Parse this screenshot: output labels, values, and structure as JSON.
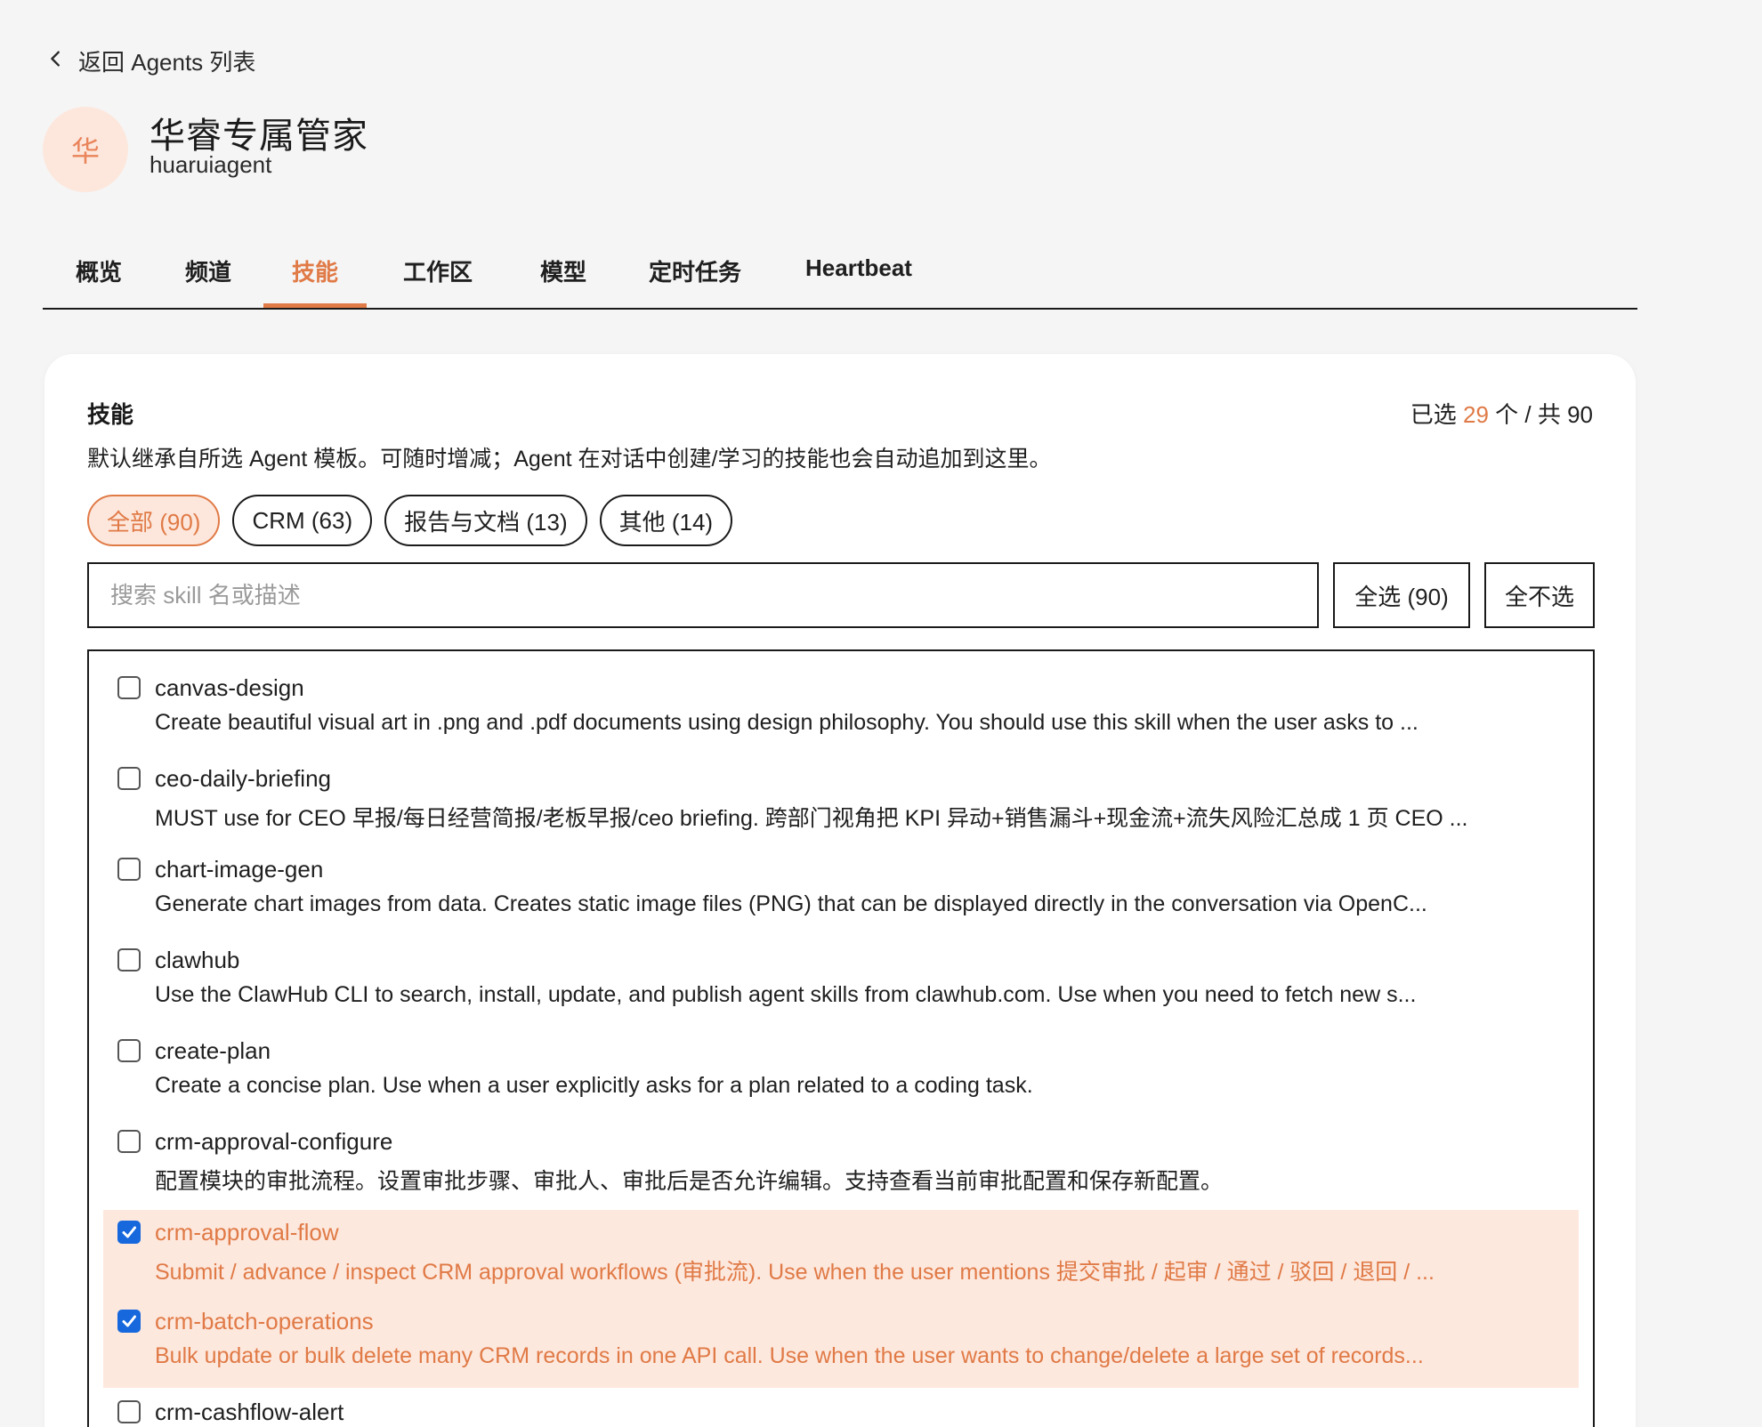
{
  "back": {
    "label": "返回 Agents 列表"
  },
  "agent": {
    "avatar_char": "华",
    "name": "华睿专属管家",
    "id": "huaruiagent"
  },
  "tabs": [
    {
      "label": "概览"
    },
    {
      "label": "频道"
    },
    {
      "label": "技能",
      "active": true
    },
    {
      "label": "工作区"
    },
    {
      "label": "模型"
    },
    {
      "label": "定时任务"
    },
    {
      "label": "Heartbeat"
    }
  ],
  "skills_panel": {
    "title": "技能",
    "count_prefix": "已选",
    "selected": "29",
    "count_suffix": "个 / 共 90",
    "description": "默认继承自所选 Agent 模板。可随时增减；Agent 在对话中创建/学习的技能也会自动追加到这里。",
    "filters": [
      {
        "label": "全部 (90)",
        "active": true
      },
      {
        "label": "CRM (63)"
      },
      {
        "label": "报告与文档 (13)"
      },
      {
        "label": "其他 (14)"
      }
    ],
    "search": {
      "placeholder": "搜索 skill 名或描述",
      "value": ""
    },
    "select_all_label": "全选 (90)",
    "select_none_label": "全不选",
    "skills": [
      {
        "name": "canvas-design",
        "checked": false,
        "description": "Create beautiful visual art in .png and .pdf documents using design philosophy. You should use this skill when the user asks to ..."
      },
      {
        "name": "ceo-daily-briefing",
        "checked": false,
        "description": "MUST use for CEO 早报/每日经营简报/老板早报/ceo briefing. 跨部门视角把 KPI 异动+销售漏斗+现金流+流失风险汇总成 1 页 CEO ..."
      },
      {
        "name": "chart-image-gen",
        "checked": false,
        "description": "Generate chart images from data. Creates static image files (PNG) that can be displayed directly in the conversation via OpenC..."
      },
      {
        "name": "clawhub",
        "checked": false,
        "description": "Use the ClawHub CLI to search, install, update, and publish agent skills from clawhub.com. Use when you need to fetch new s..."
      },
      {
        "name": "create-plan",
        "checked": false,
        "description": "Create a concise plan. Use when a user explicitly asks for a plan related to a coding task."
      },
      {
        "name": "crm-approval-configure",
        "checked": false,
        "description": "配置模块的审批流程。设置审批步骤、审批人、审批后是否允许编辑。支持查看当前审批配置和保存新配置。"
      },
      {
        "name": "crm-approval-flow",
        "checked": true,
        "description": "Submit / advance / inspect CRM approval workflows (审批流). Use when the user mentions 提交审批 / 起审 / 通过 / 驳回 / 退回 / ..."
      },
      {
        "name": "crm-batch-operations",
        "checked": true,
        "description": "Bulk update or bulk delete many CRM records in one API call. Use when the user wants to change/delete a large set of records..."
      },
      {
        "name": "crm-cashflow-alert",
        "checked": false,
        "description": ""
      }
    ]
  }
}
